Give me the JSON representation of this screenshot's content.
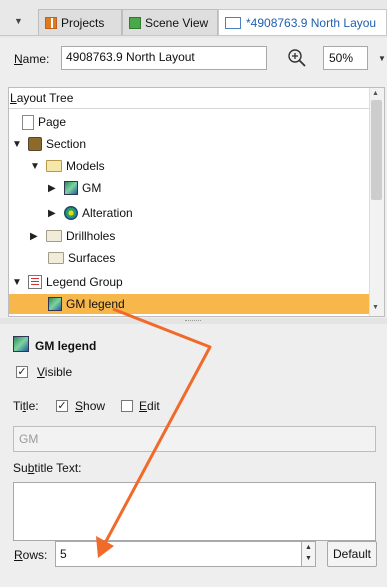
{
  "tabs": [
    {
      "label": "Projects",
      "icon": "grid-icon"
    },
    {
      "label": "Scene View",
      "icon": "cube-icon"
    },
    {
      "label": "*4908763.9 North Layou",
      "icon": "layout-icon"
    }
  ],
  "name_label_prefix": "",
  "name_label_underlined": "N",
  "name_label_rest": "ame:",
  "name_value": "4908763.9 North Layout",
  "zoom_value": "50%",
  "tree": {
    "header_underlined": "L",
    "header_rest": "ayout Tree",
    "items": [
      {
        "label": "Page",
        "icon": "page-icon"
      },
      {
        "label": "Section",
        "icon": "section-icon"
      },
      {
        "label": "Models",
        "icon": "folder-icon"
      },
      {
        "label": "GM",
        "icon": "gm-model-icon"
      },
      {
        "label": "Alteration",
        "icon": "alteration-icon"
      },
      {
        "label": "Drillholes",
        "icon": "folder-icon"
      },
      {
        "label": "Surfaces",
        "icon": "folder-icon"
      },
      {
        "label": "Legend Group",
        "icon": "legend-group-icon"
      },
      {
        "label": "GM legend",
        "icon": "gm-legend-icon",
        "selected": true
      }
    ]
  },
  "properties": {
    "title": "GM legend",
    "visible_underlined": "V",
    "visible_rest": "isible",
    "visible_checked": true,
    "title_label_a": "Ti",
    "title_label_u": "t",
    "title_label_b": "le:",
    "show_underlined": "S",
    "show_rest": "how",
    "show_checked": true,
    "edit_underlined": "E",
    "edit_rest": "dit",
    "edit_checked": false,
    "title_value": "GM",
    "subtitle_label_a": "Su",
    "subtitle_label_u": "b",
    "subtitle_label_b": "title Text:",
    "rows_underlined": "R",
    "rows_rest": "ows:",
    "rows_value": "5",
    "default_label": "Default"
  },
  "colors": {
    "selection": "#f7b74b",
    "annotation_arrow": "#f06a2a"
  }
}
